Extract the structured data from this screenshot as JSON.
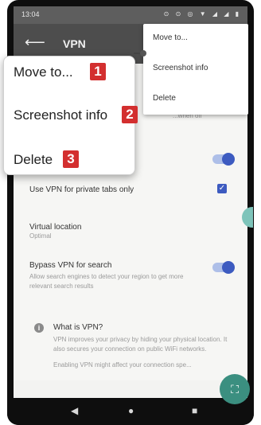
{
  "status_bar": {
    "time": "13:04",
    "icons": "⊙ ⊙ ◎ ▼ ◢ ◢ ▮"
  },
  "app_bar": {
    "title": "VPN",
    "back_icon": "arrow-back-icon"
  },
  "settings": {
    "partial_subtitle": "...when off",
    "vpn_private_tabs": {
      "label": "Use VPN for private tabs only",
      "checked": true
    },
    "virtual_location": {
      "label": "Virtual location",
      "value": "Optimal"
    },
    "bypass_vpn": {
      "label": "Bypass VPN for search",
      "description": "Allow search engines to detect your region to get more relevant search results"
    },
    "what_is_vpn": {
      "title": "What is VPN?",
      "body": "VPN improves your privacy by hiding your physical location. It also secures your connection on public WiFi networks.",
      "footer": "Enabling VPN might affect your connection spe..."
    }
  },
  "context_menu": {
    "items": [
      "Move to...",
      "Screenshot info",
      "Delete"
    ]
  },
  "callout": {
    "items": [
      {
        "label": "Move to...",
        "badge": "1"
      },
      {
        "label": "Screenshot info",
        "badge": "2"
      },
      {
        "label": "Delete",
        "badge": "3"
      }
    ],
    "badge_color": "#d32f2f"
  },
  "fab": {
    "icon": "screenshot-scan-icon",
    "glyph": "⛶"
  },
  "nav_bar": {
    "back": "◀",
    "home": "●",
    "recents": "■"
  },
  "colors": {
    "accent": "#3d5bc0",
    "fab": "#3b8f80",
    "appbar": "#4d4d4d"
  }
}
